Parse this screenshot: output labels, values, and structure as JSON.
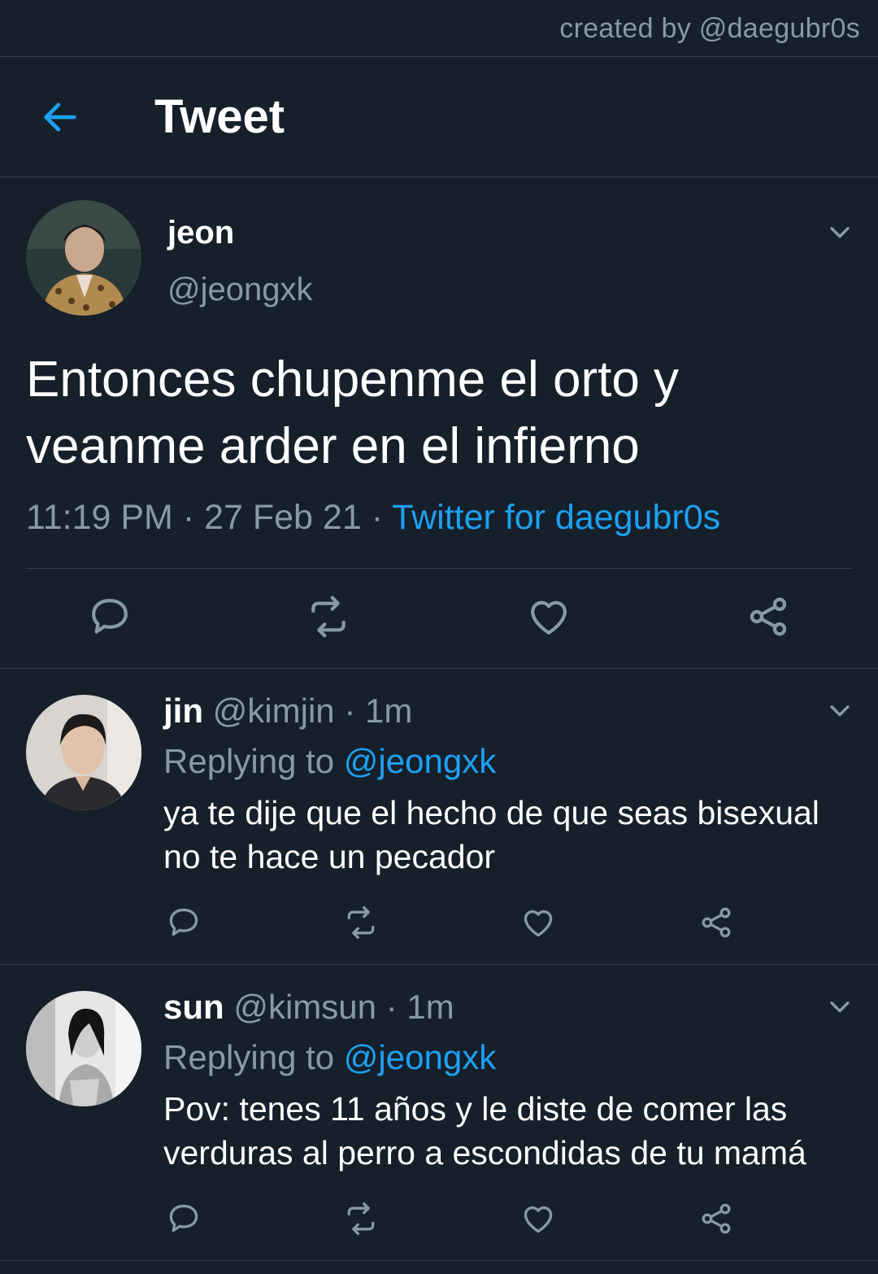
{
  "credit": "created by @daegubr0s",
  "header": {
    "title": "Tweet"
  },
  "main_tweet": {
    "author_name": "jeon",
    "author_handle": "@jeongxk",
    "text": "Entonces chupenme el orto y veanme arder en el infierno",
    "time": "11:19 PM",
    "date": "27 Feb 21",
    "source": "Twitter for daegubr0s",
    "separator": " · "
  },
  "replies": [
    {
      "name": "jin",
      "handle": "@kimjin",
      "time": "1m",
      "replying_label": "Replying to ",
      "replying_to": "@jeongxk",
      "text": "ya te dije que el hecho de que seas bisexual no te hace un pecador"
    },
    {
      "name": "sun",
      "handle": "@kimsun",
      "time": "1m",
      "replying_label": "Replying to ",
      "replying_to": "@jeongxk",
      "text": "Pov: tenes 11 años y le diste de comer las verduras al perro a escondidas de tu mamá"
    }
  ],
  "icons": {
    "back": "arrow-left-icon",
    "menu": "chevron-down-icon",
    "reply": "comment-icon",
    "retweet": "retweet-icon",
    "like": "heart-icon",
    "share": "share-icon"
  },
  "colors": {
    "background": "#15202b",
    "accent": "#1da1f2",
    "secondary_text": "#8899a6",
    "divider": "#38444d"
  }
}
